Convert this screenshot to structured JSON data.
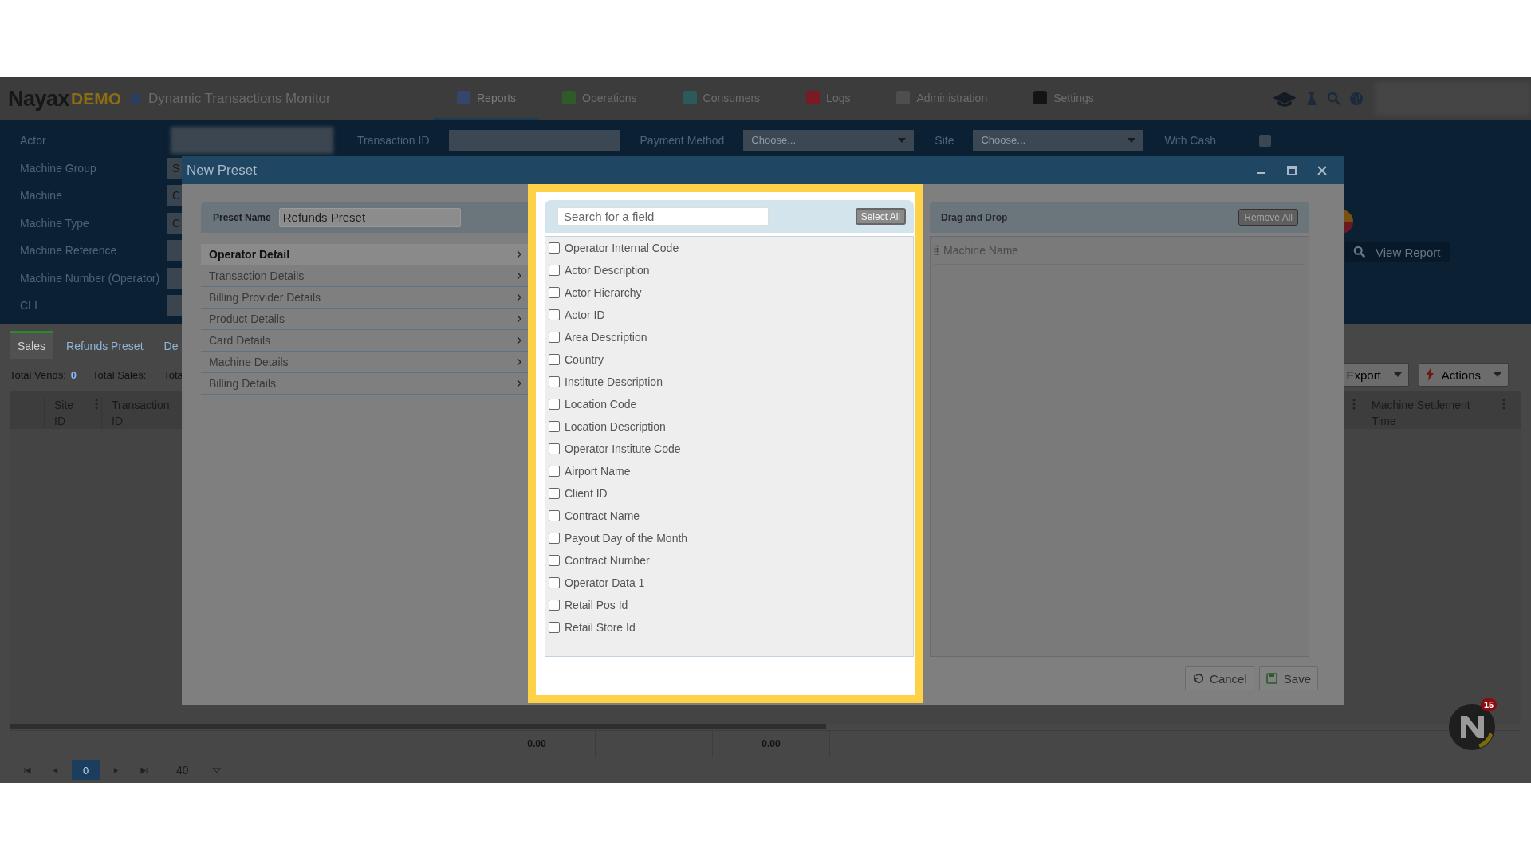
{
  "header": {
    "logo": "Nayax",
    "logo_badge": "DEMO",
    "title": "Dynamic Transactions Monitor",
    "nav": [
      {
        "label": "Reports",
        "selected": true,
        "color": "#34466b"
      },
      {
        "label": "Operations",
        "selected": false,
        "color": "#2f5a2a"
      },
      {
        "label": "Consumers",
        "selected": false,
        "color": "#2a5a5a"
      },
      {
        "label": "Logs",
        "selected": false,
        "color": "#7a1a24"
      },
      {
        "label": "Administration",
        "selected": false,
        "color": "#4e4e4e"
      },
      {
        "label": "Settings",
        "selected": false,
        "color": "#141414"
      }
    ]
  },
  "filters": {
    "left": [
      {
        "label": "Actor",
        "kind": "blurred"
      },
      {
        "label": "Machine Group",
        "kind": "text",
        "value": "S"
      },
      {
        "label": "Machine",
        "kind": "text",
        "value": "C"
      },
      {
        "label": "Machine Type",
        "kind": "text",
        "value": "C"
      },
      {
        "label": "Machine Reference",
        "kind": "text"
      },
      {
        "label": "Machine Number (Operator)",
        "kind": "text"
      },
      {
        "label": "CLI",
        "kind": "text"
      }
    ],
    "top_row": [
      {
        "label": "Transaction ID",
        "kind": "text"
      },
      {
        "label": "Payment Method",
        "kind": "select",
        "placeholder": "Choose..."
      },
      {
        "label": "Site",
        "kind": "select",
        "placeholder": "Choose..."
      },
      {
        "label": "With Cash",
        "kind": "checkbox",
        "checked": false
      }
    ],
    "view_report": "View Report"
  },
  "tabs": [
    {
      "label": "Sales",
      "selected": true
    },
    {
      "label": "Refunds Preset",
      "selected": false
    },
    {
      "label": "De",
      "selected": false
    }
  ],
  "totals": [
    {
      "label": "Total Vends:",
      "value": "0"
    },
    {
      "label": "Total Sales:"
    },
    {
      "label": "Tota"
    }
  ],
  "toolbar": [
    "Export",
    "Actions"
  ],
  "table": {
    "columns": [
      "Site ID",
      "Transaction ID"
    ],
    "right_columns": [
      "Machine Settlement Time"
    ],
    "footer_totals": [
      "0.00",
      "0.00"
    ]
  },
  "pager": {
    "page": "0",
    "page_size": "40"
  },
  "notifications": {
    "count": "15"
  },
  "modal": {
    "title": "New Preset",
    "preset_name_label": "Preset Name",
    "preset_name": "Refunds Preset",
    "categories": [
      {
        "label": "Operator Detail",
        "selected": true
      },
      {
        "label": "Transaction Details",
        "selected": false
      },
      {
        "label": "Billing Provider Details",
        "selected": false
      },
      {
        "label": "Product Details",
        "selected": false
      },
      {
        "label": "Card Details",
        "selected": false
      },
      {
        "label": "Machine Details",
        "selected": false
      },
      {
        "label": "Billing Details",
        "selected": false
      }
    ],
    "search": {
      "placeholder": "Search for a field"
    },
    "select_all": "Select All",
    "fields": [
      {
        "label": "Operator Internal Code",
        "checked": false
      },
      {
        "label": "Actor Description",
        "checked": false
      },
      {
        "label": "Actor Hierarchy",
        "checked": false
      },
      {
        "label": "Actor ID",
        "checked": false
      },
      {
        "label": "Area Description",
        "checked": false
      },
      {
        "label": "Country",
        "checked": false
      },
      {
        "label": "Institute Description",
        "checked": false
      },
      {
        "label": "Location Code",
        "checked": false
      },
      {
        "label": "Location Description",
        "checked": false
      },
      {
        "label": "Operator Institute Code",
        "checked": false
      },
      {
        "label": "Airport Name",
        "checked": false
      },
      {
        "label": "Client ID",
        "checked": false
      },
      {
        "label": "Contract Name",
        "checked": false
      },
      {
        "label": "Payout Day of the Month",
        "checked": false
      },
      {
        "label": "Contract Number",
        "checked": false
      },
      {
        "label": "Operator Data 1",
        "checked": false
      },
      {
        "label": "Retail Pos Id",
        "checked": false
      },
      {
        "label": "Retail Store Id",
        "checked": false
      }
    ],
    "drop_title": "Drag and Drop",
    "remove_all": "Remove All",
    "dropped": [
      "Machine Name"
    ],
    "buttons": [
      {
        "label": "Cancel",
        "kind": "cancel"
      },
      {
        "label": "Save",
        "kind": "save"
      }
    ]
  }
}
